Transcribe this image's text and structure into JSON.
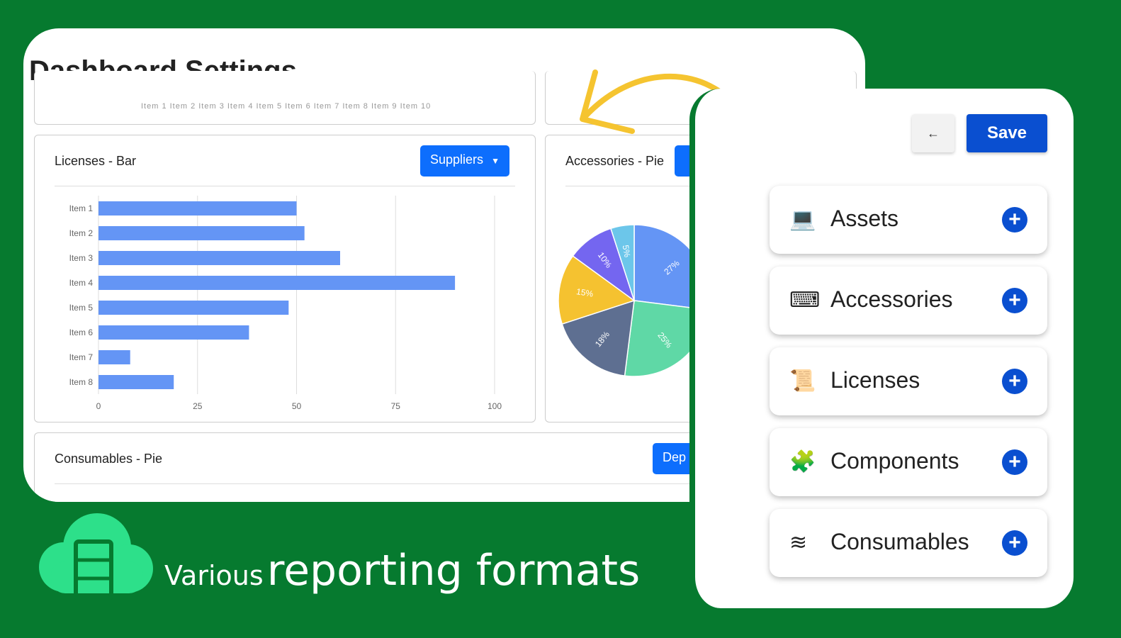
{
  "page_title": "Dashboard Settings",
  "top_card_ticks": "Item 1   Item 2   Item 3   Item 4   Item 5   Item 6   Item 7   Item 8   Item 9   Item 10",
  "cards": {
    "licenses": {
      "title": "Licenses - Bar",
      "button": "Suppliers"
    },
    "accessories": {
      "title": "Accessories - Pie"
    },
    "consumables": {
      "title": "Consumables - Pie",
      "button": "Dep"
    }
  },
  "chart_data": [
    {
      "type": "bar",
      "orientation": "horizontal",
      "title": "Licenses - Bar",
      "categories": [
        "Item 1",
        "Item 2",
        "Item 3",
        "Item 4",
        "Item 5",
        "Item 6",
        "Item 7",
        "Item 8"
      ],
      "values": [
        50,
        52,
        61,
        90,
        48,
        38,
        8,
        19
      ],
      "xlim": [
        0,
        100
      ],
      "xticks": [
        "0",
        "25",
        "50",
        "75",
        "100"
      ],
      "color": "#6495f5"
    },
    {
      "type": "pie",
      "title": "Accessories - Pie",
      "values": [
        27,
        25,
        18,
        15,
        10,
        5
      ],
      "labels": [
        "27%",
        "25%",
        "18%",
        "15%",
        "10%",
        "5%"
      ],
      "colors": [
        "#6495f5",
        "#5fd8a6",
        "#5e6f91",
        "#f5c230",
        "#7466f0",
        "#6cc6ea"
      ]
    }
  ],
  "side": {
    "back": "←",
    "save": "Save",
    "items": [
      {
        "label": "Assets",
        "icon": "laptop-icon",
        "glyph": "💻"
      },
      {
        "label": "Accessories",
        "icon": "keyboard-icon",
        "glyph": "⌨"
      },
      {
        "label": "Licenses",
        "icon": "scroll-icon",
        "glyph": "📜"
      },
      {
        "label": "Components",
        "icon": "puzzle-icon",
        "glyph": "🧩"
      },
      {
        "label": "Consumables",
        "icon": "layers-icon",
        "glyph": "≋"
      }
    ],
    "plus": "+"
  },
  "caption": {
    "small": "Various",
    "large": "reporting formats"
  }
}
